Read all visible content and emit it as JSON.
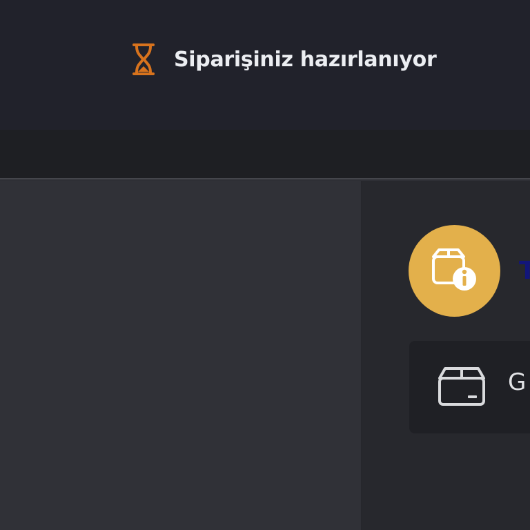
{
  "header": {
    "status_icon": "hourglass-icon",
    "status_text": "Siparişiniz hazırlanıyor"
  },
  "order_info": {
    "badge_icon": "package-info-icon",
    "title_partial": "T"
  },
  "cargo_card": {
    "icon": "box-icon",
    "text_partial": "G"
  },
  "colors": {
    "header_bg": "#21222b",
    "accent_orange": "#d8731d",
    "badge_yellow": "#e3b04b",
    "title_blue": "#12167a"
  }
}
